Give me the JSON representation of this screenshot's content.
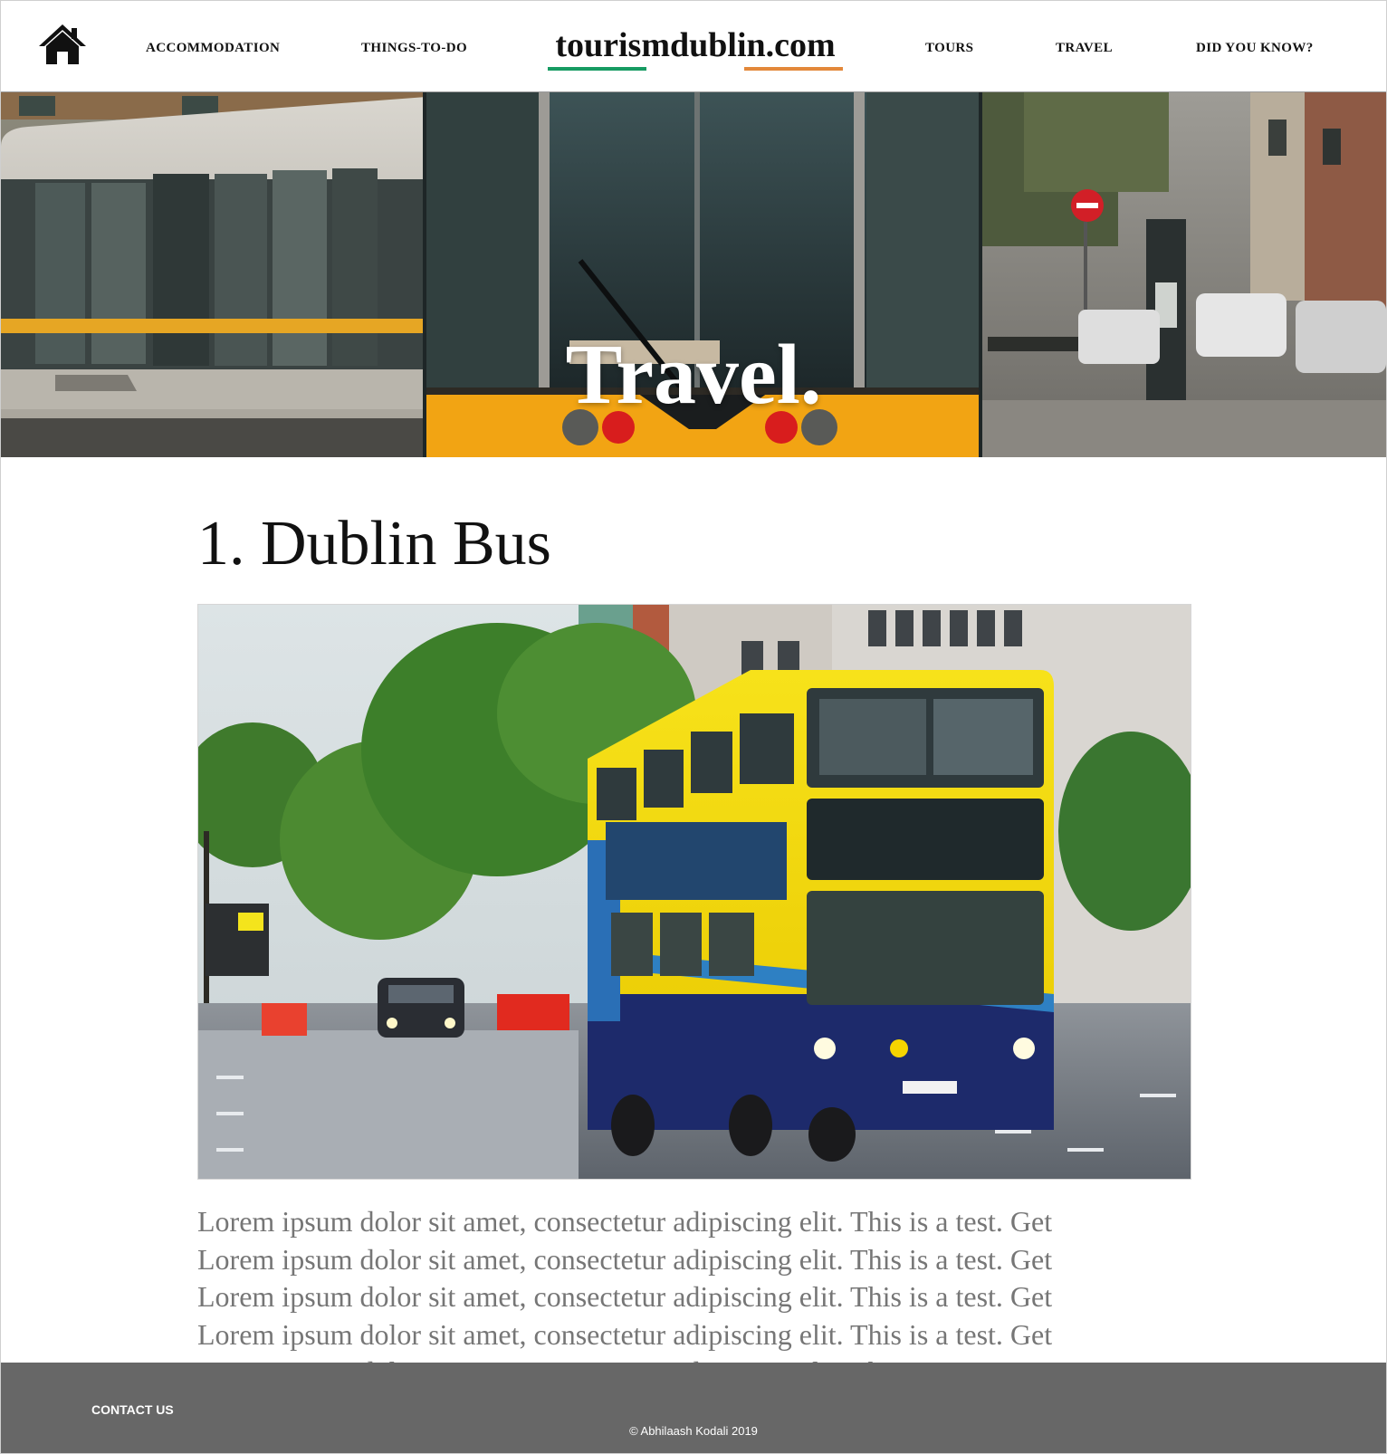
{
  "header": {
    "home_icon": "home-icon",
    "brand": "tourismdublin.com",
    "brand_underline_colors": [
      "#169b62",
      "#ffffff",
      "#e3883a"
    ],
    "nav": {
      "accommodation": "ACCOMMODATION",
      "things_to_do": "THINGS-TO-DO",
      "tours": "TOURS",
      "travel": "TRAVEL",
      "did_you_know": "DID YOU KNOW?"
    }
  },
  "hero": {
    "title": "Travel.",
    "image": "dublin-luas-tram-photo"
  },
  "main": {
    "section_heading": "1. Dublin Bus",
    "image": "dublin-bus-photo",
    "body_lines": [
      "Lorem ipsum dolor sit amet, consectetur adipiscing elit. This is a test. Get",
      "Lorem ipsum dolor sit amet, consectetur adipiscing elit. This is a test. Get",
      "Lorem ipsum dolor sit amet, consectetur adipiscing elit. This is a test. Get",
      "Lorem ipsum dolor sit amet, consectetur adipiscing elit. This is a test. Get",
      "Lorem ipsum dolor sit amet, consectetur adipiscing elit. This is a test. Get"
    ]
  },
  "footer": {
    "contact": "CONTACT US",
    "copyright": "© Abhilaash Kodali 2019"
  },
  "colors": {
    "footer_bg": "#676767",
    "body_text": "#767676",
    "tram_yellow": "#f2a413",
    "bus_yellow": "#f5dc00",
    "bus_blue": "#1d2a6b"
  }
}
